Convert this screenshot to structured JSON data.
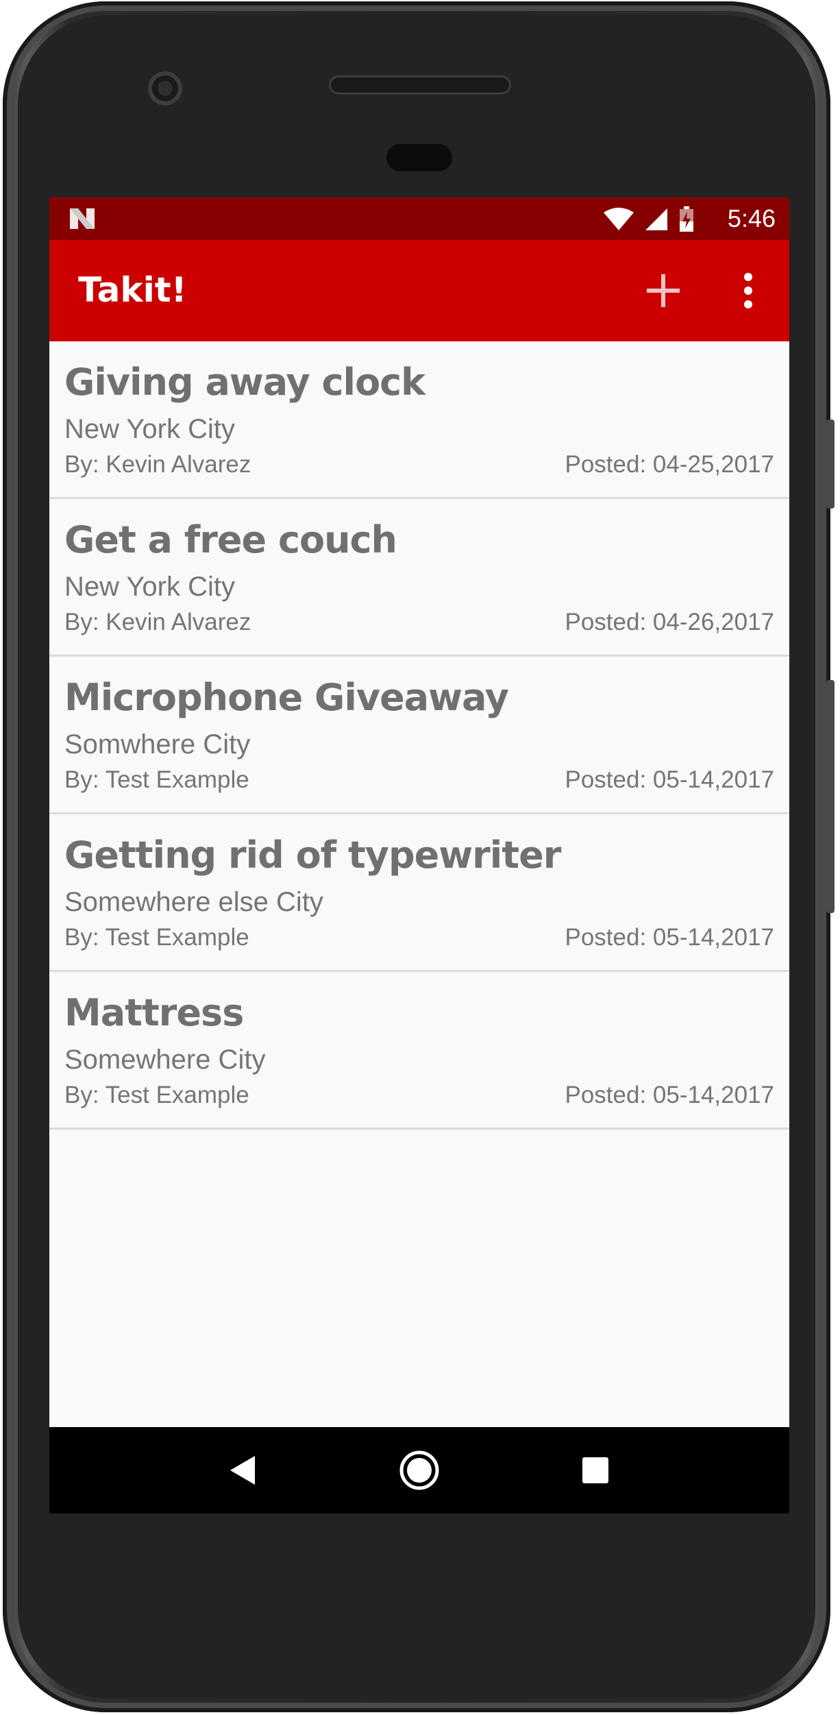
{
  "status_bar": {
    "time": "5:46",
    "icons": [
      "notification-n-icon",
      "wifi-icon",
      "signal-icon",
      "battery-charging-icon"
    ]
  },
  "app_bar": {
    "title": "Takit!",
    "actions": [
      "add-icon",
      "more-vert-icon"
    ]
  },
  "posts": [
    {
      "title": "Giving away clock",
      "location": "New York City",
      "author": "By: Kevin Alvarez",
      "posted": "Posted: 04-25,2017"
    },
    {
      "title": "Get a free couch",
      "location": "New York City",
      "author": "By: Kevin Alvarez",
      "posted": "Posted: 04-26,2017"
    },
    {
      "title": "Microphone Giveaway",
      "location": "Somwhere City",
      "author": "By: Test Example",
      "posted": "Posted: 05-14,2017"
    },
    {
      "title": "Getting rid of typewriter",
      "location": "Somewhere else City",
      "author": "By: Test Example",
      "posted": "Posted: 05-14,2017"
    },
    {
      "title": "Mattress",
      "location": "Somewhere City",
      "author": "By: Test Example",
      "posted": "Posted: 05-14,2017"
    }
  ],
  "nav_bar": {
    "buttons": [
      "back-icon",
      "home-icon",
      "recents-icon"
    ]
  },
  "colors": {
    "status_bar": "#870000",
    "app_bar": "#cc0000",
    "background": "#f9f9f9",
    "text_primary": "#707070",
    "nav_bar": "#000000"
  }
}
